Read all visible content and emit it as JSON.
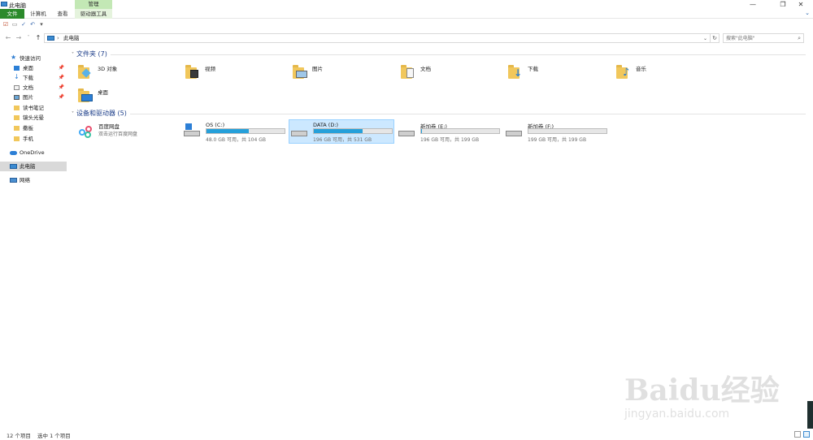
{
  "window": {
    "title": "此电脑",
    "manage_label": "管理",
    "minimize": "—",
    "maximize": "❐",
    "close": "✕"
  },
  "ribbon": {
    "tabs": [
      {
        "label": "文件"
      },
      {
        "label": "计算机"
      },
      {
        "label": "查看"
      },
      {
        "label": "驱动器工具"
      }
    ]
  },
  "address": {
    "path": "此电脑",
    "separator": "›",
    "search_placeholder": "搜索\"此电脑\""
  },
  "sidebar": {
    "items": [
      {
        "label": "快速访问",
        "pinned": false
      },
      {
        "label": "桌面",
        "pinned": true
      },
      {
        "label": "下载",
        "pinned": true
      },
      {
        "label": "文档",
        "pinned": true
      },
      {
        "label": "图片",
        "pinned": true
      },
      {
        "label": "读书笔记",
        "pinned": false
      },
      {
        "label": "镜头光晕",
        "pinned": false
      },
      {
        "label": "撒板",
        "pinned": false
      },
      {
        "label": "手机",
        "pinned": false
      },
      {
        "label": "OneDrive",
        "pinned": false
      },
      {
        "label": "此电脑",
        "pinned": false
      },
      {
        "label": "网络",
        "pinned": false
      }
    ]
  },
  "folders_section": {
    "title": "文件夹 (7)",
    "items": [
      {
        "label": "3D 对象"
      },
      {
        "label": "视频"
      },
      {
        "label": "图片"
      },
      {
        "label": "文档"
      },
      {
        "label": "下载"
      },
      {
        "label": "音乐"
      },
      {
        "label": "桌面"
      }
    ]
  },
  "devices_section": {
    "title": "设备和驱动器 (5)",
    "cloud": {
      "name": "百度网盘",
      "subtitle": "双击运行百度网盘"
    },
    "drives": [
      {
        "name": "OS (C:)",
        "info": "48.0 GB 可用，共 104 GB",
        "used_fraction": 0.54
      },
      {
        "name": "DATA (D:)",
        "info": "196 GB 可用，共 531 GB",
        "used_fraction": 0.63
      },
      {
        "name": "新加卷 (E:)",
        "info": "196 GB 可用，共 199 GB",
        "used_fraction": 0.015
      },
      {
        "name": "新加卷 (F:)",
        "info": "199 GB 可用，共 199 GB",
        "used_fraction": 0.0
      }
    ]
  },
  "status": {
    "count": "12 个项目",
    "selected": "选中 1 个项目"
  },
  "watermark": {
    "brand": "Baidu经验",
    "site": "jingyan.baidu.com"
  },
  "colors": {
    "accent": "#26a0da",
    "file_tab": "#2b8a2b",
    "manage_tab": "#c3e8b5",
    "selection": "#cce8ff",
    "section_title": "#1e3f8a"
  }
}
